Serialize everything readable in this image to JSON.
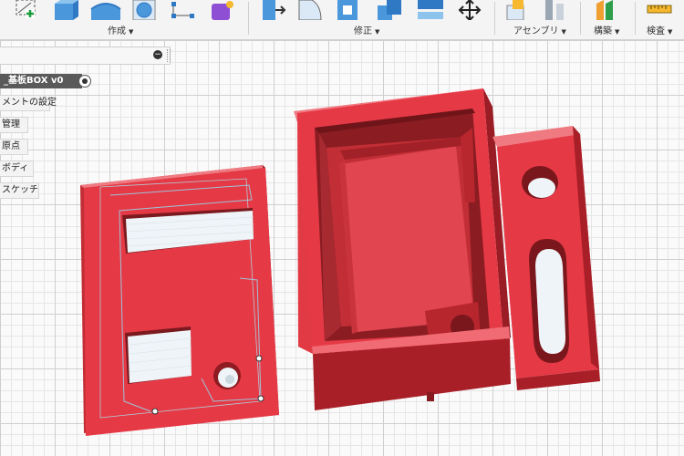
{
  "toolbar": {
    "groups": [
      {
        "label": "作成"
      },
      {
        "label": "修正"
      },
      {
        "label": "アセンブリ"
      },
      {
        "label": "構築"
      },
      {
        "label": "検査"
      }
    ]
  },
  "browser": {
    "title": "_基板BOX v0",
    "nodes": [
      {
        "label": "メントの設定"
      },
      {
        "label": "管理"
      },
      {
        "label": "原点"
      },
      {
        "label": "ボディ"
      },
      {
        "label": "スケッチ"
      }
    ]
  },
  "colors": {
    "model_red": "#e63946",
    "toolbar_bg": "#f4f4f4",
    "browser_header": "#5a5a5a"
  }
}
